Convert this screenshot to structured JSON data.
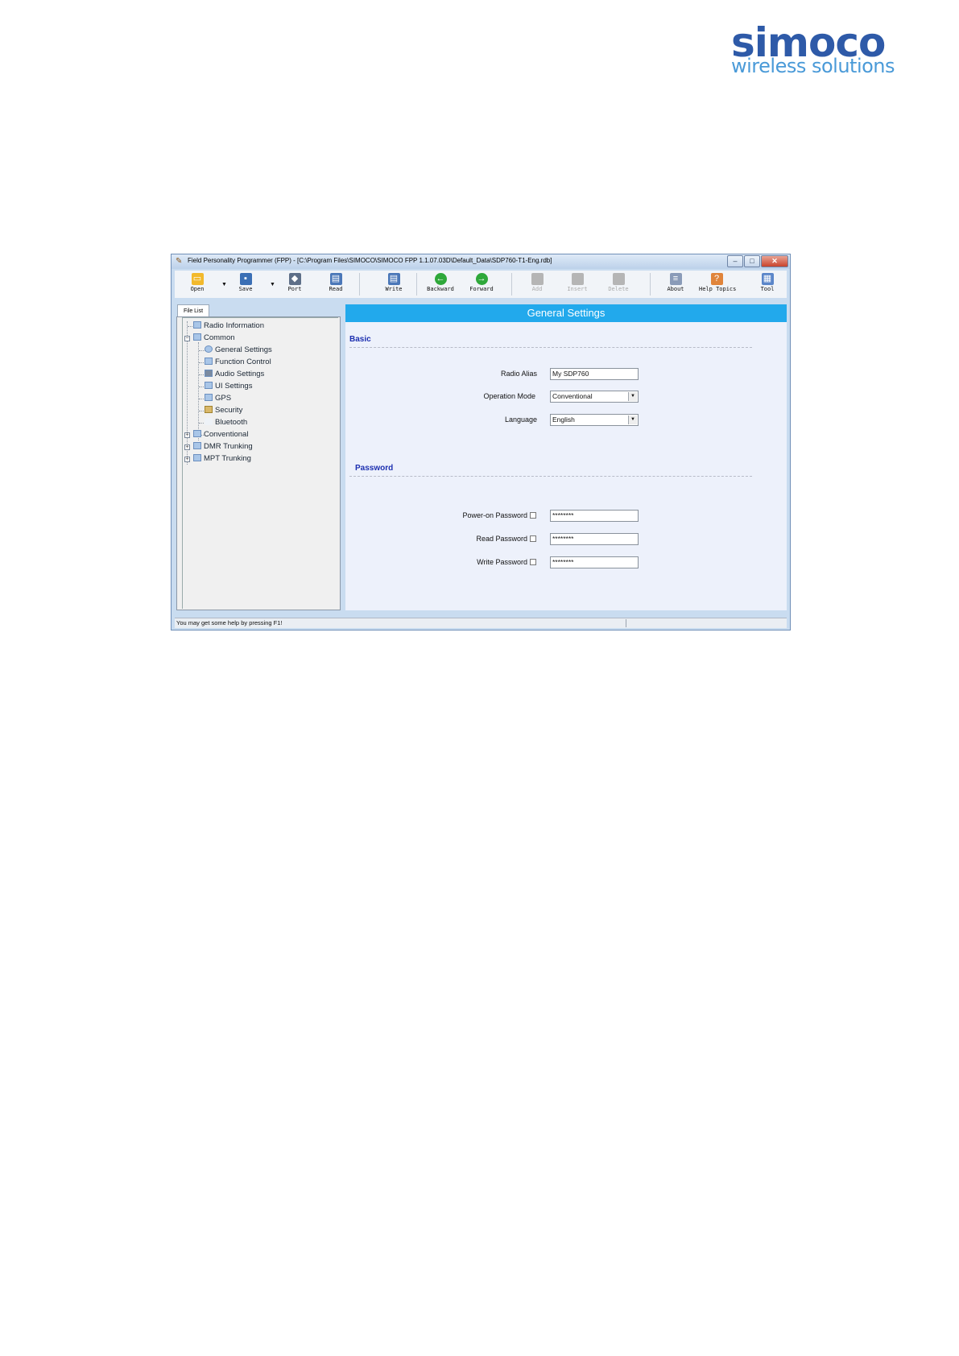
{
  "logo": {
    "main": "simoco",
    "sub": "wireless solutions"
  },
  "window": {
    "title": "Field Personality Programmer (FPP) - [C:\\Program Files\\SIMOCO\\SIMOCO FPP 1.1.07.03D\\Default_Data\\SDP760-T1-Eng.rdb]",
    "controls": {
      "minimize": "–",
      "maximize": "□",
      "close": "✕"
    }
  },
  "toolbar": {
    "items": [
      {
        "label": "Open",
        "icon": "folder-icon",
        "color": "#f2b92c"
      },
      {
        "label": "Save",
        "icon": "floppy-icon",
        "color": "#3a6fb5"
      },
      {
        "label": "Port",
        "icon": "port-icon",
        "color": "#5e6f88"
      },
      {
        "label": "Read",
        "icon": "read-icon",
        "color": "#4a77b8"
      },
      {
        "label": "Write",
        "icon": "write-icon",
        "color": "#4a77b8"
      },
      {
        "label": "Backward",
        "icon": "back-arrow-icon",
        "color": "#2ea83a"
      },
      {
        "label": "Forward",
        "icon": "forward-arrow-icon",
        "color": "#2ea83a"
      },
      {
        "label": "Add",
        "icon": "add-icon",
        "color": "#b5b5b5"
      },
      {
        "label": "Insert",
        "icon": "insert-icon",
        "color": "#b5b5b5"
      },
      {
        "label": "Delete",
        "icon": "delete-icon",
        "color": "#b5b5b5"
      },
      {
        "label": "About",
        "icon": "about-icon",
        "color": "#8a9bb8"
      },
      {
        "label": "Help Topics",
        "icon": "help-icon",
        "color": "#e0843a"
      },
      {
        "label": "Tool",
        "icon": "tool-icon",
        "color": "#5b86c9"
      }
    ]
  },
  "left_tab": "File List",
  "tree": {
    "radio_information": "Radio Information",
    "common": "Common",
    "general_settings": "General Settings",
    "function_control": "Function Control",
    "audio_settings": "Audio Settings",
    "ui_settings": "UI Settings",
    "gps": "GPS",
    "security": "Security",
    "bluetooth": "Bluetooth",
    "conventional": "Conventional",
    "dmr_trunking": "DMR Trunking",
    "mpt_trunking": "MPT Trunking"
  },
  "main": {
    "header": "General Settings",
    "basic": {
      "title": "Basic",
      "radio_alias_label": "Radio Alias",
      "radio_alias_value": "My SDP760",
      "operation_mode_label": "Operation Mode",
      "operation_mode_value": "Conventional",
      "language_label": "Language",
      "language_value": "English"
    },
    "password": {
      "title": "Password",
      "power_on_label": "Power-on Password",
      "power_on_value": "********",
      "read_label": "Read Password",
      "read_value": "********",
      "write_label": "Write Password",
      "write_value": "********"
    }
  },
  "status": "You may get some help by pressing F1!"
}
